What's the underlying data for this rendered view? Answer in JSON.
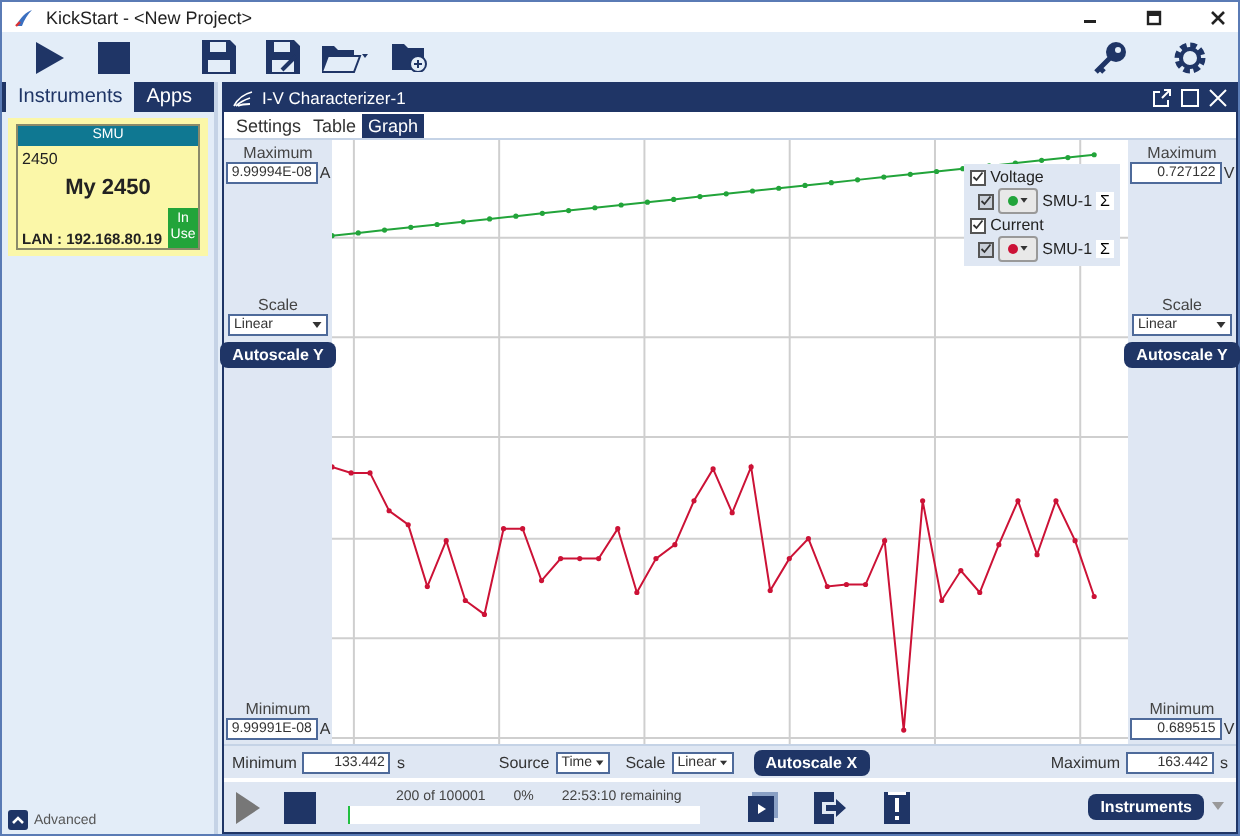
{
  "window": {
    "title": "KickStart - <New Project>"
  },
  "sidebar": {
    "tabs": [
      {
        "label": "Instruments",
        "selected": true
      },
      {
        "label": "Apps",
        "selected": false
      }
    ],
    "instrument_card": {
      "header": "SMU",
      "model": "2450",
      "name": "My 2450",
      "address": "LAN : 192.168.80.19",
      "status": "In Use"
    },
    "advanced_label": "Advanced"
  },
  "panel": {
    "title": "I-V Characterizer-1",
    "tabs": [
      {
        "label": "Settings",
        "selected": false
      },
      {
        "label": "Table",
        "selected": false
      },
      {
        "label": "Graph",
        "selected": true
      }
    ]
  },
  "graph": {
    "left_axis": {
      "max_label": "Maximum",
      "max": "9.99994E-08",
      "max_unit": "A",
      "min_unit": "A",
      "scale_label": "Scale",
      "scale": "Linear",
      "autoscale": "Autoscale Y",
      "min_label": "Minimum",
      "min": "9.99991E-08"
    },
    "right_axis": {
      "max_label": "Maximum",
      "max": "0.727122",
      "max_unit": "V",
      "min_unit": "V",
      "scale_label": "Scale",
      "scale": "Linear",
      "autoscale": "Autoscale Y",
      "min_label": "Minimum",
      "min": "0.689515"
    },
    "legend": [
      {
        "label": "Voltage",
        "checked": true,
        "plot_checked": true,
        "device": "SMU-1",
        "color": "#22a43a",
        "sum": "Σ"
      },
      {
        "label": "Current",
        "checked": true,
        "plot_checked": true,
        "device": "SMU-1",
        "color": "#cc1236",
        "sum": "Σ"
      }
    ],
    "x_axis": {
      "min_label": "Minimum",
      "min": "133.442",
      "min_unit": "s",
      "source_label": "Source",
      "source": "Time",
      "scale_label": "Scale",
      "scale": "Linear",
      "autoscale": "Autoscale X",
      "max_label": "Maximum",
      "max": "163.442",
      "max_unit": "s"
    }
  },
  "run_bar": {
    "progress": "200 of 100001",
    "percent": "0%",
    "remaining": "22:53:10 remaining",
    "level": 0.002,
    "button": "Instruments"
  }
}
